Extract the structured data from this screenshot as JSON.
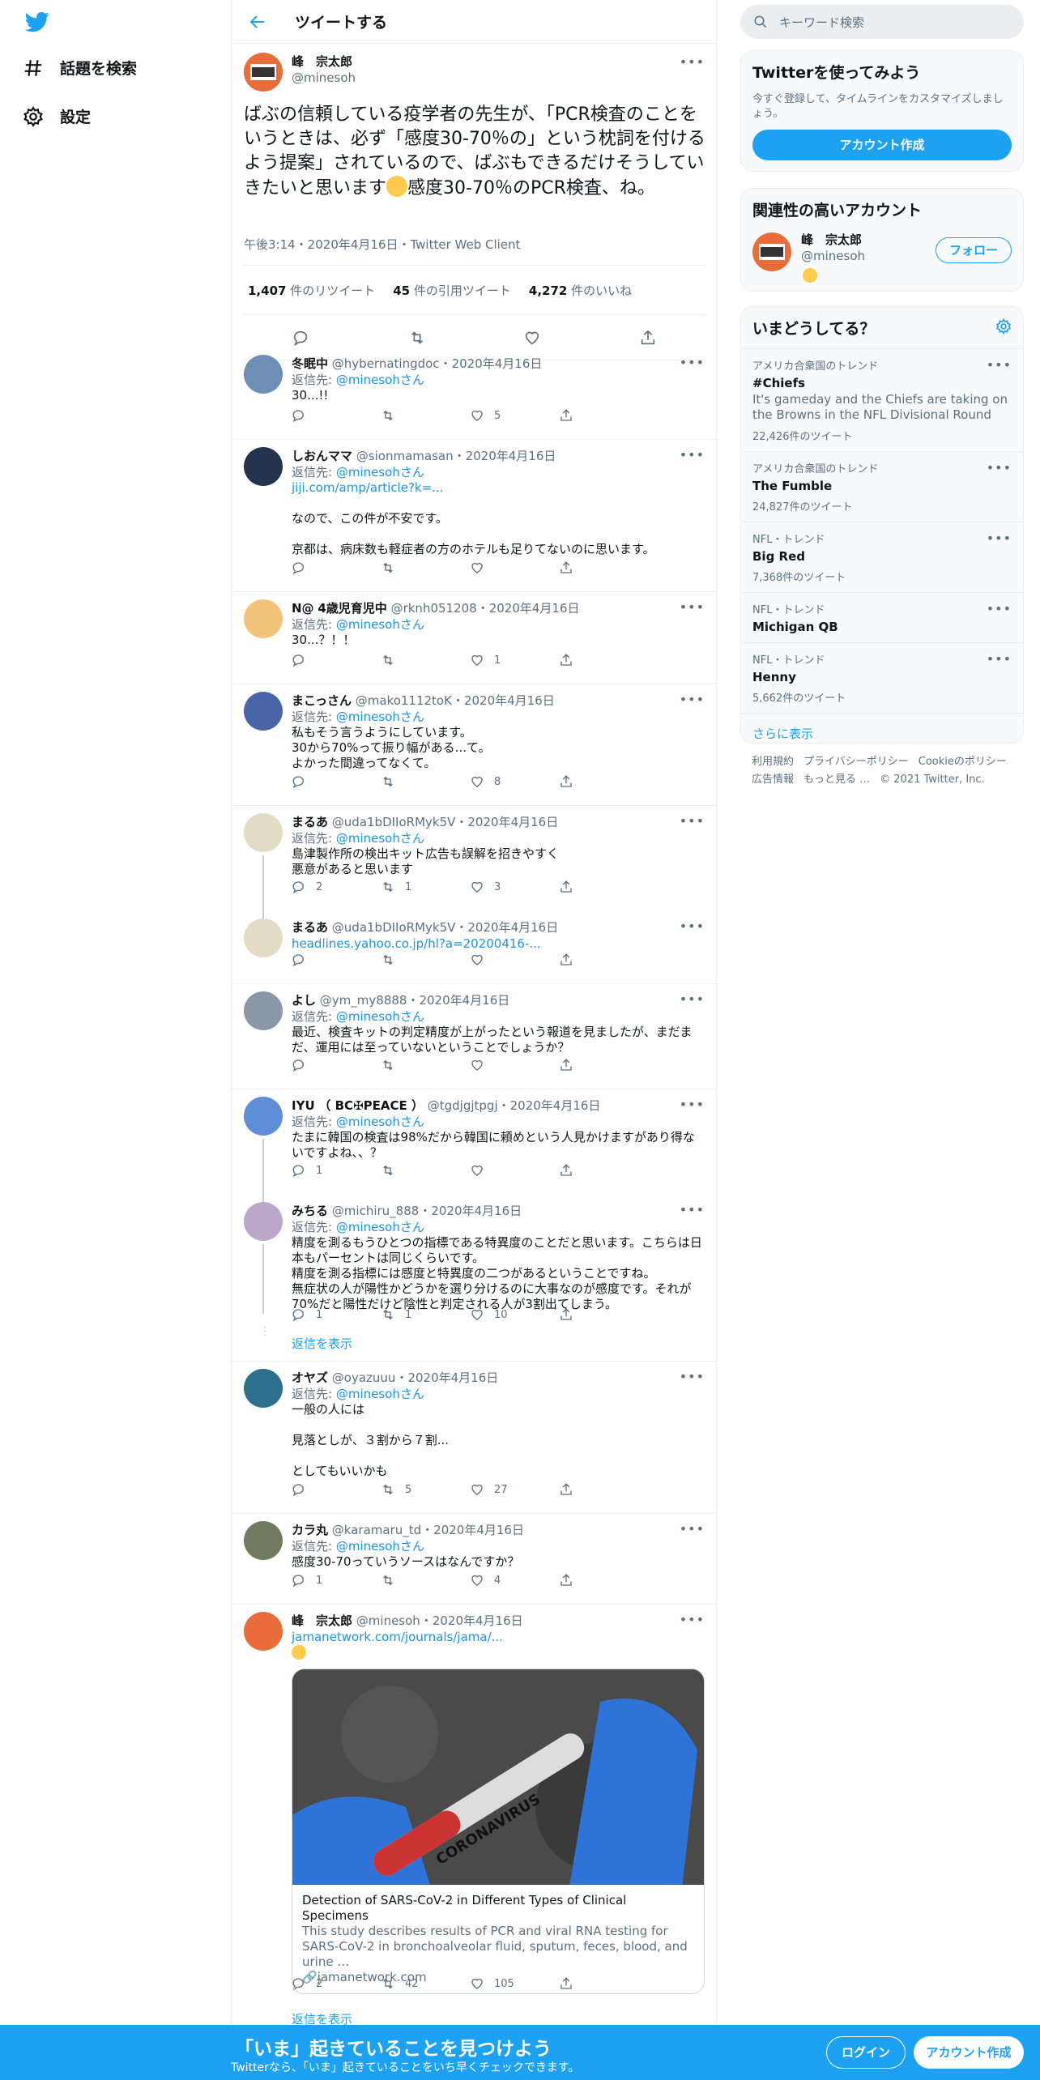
{
  "nav": {
    "explore": "話題を検索",
    "settings": "設定"
  },
  "header": {
    "title": "ツイートする"
  },
  "main_tweet": {
    "name": "峰　宗太郎",
    "handle": "@minesoh",
    "text_part1": "ばぶの信頼している疫学者の先生が、「PCR検査のことをいうときは、必ず「感度30-70％の」という枕詞を付けるよう提案」されているので、ばぶもできるだけそうしていきたいと思います",
    "text_part2": "感度30-70％のPCR検査、ね。",
    "time": "午後3:14・2020年4月16日・Twitter Web Client",
    "retweets": "1,407",
    "retweets_label": "件のリツイート",
    "quotes": "45",
    "quotes_label": "件の引用ツイート",
    "likes": "4,272",
    "likes_label": "件のいいね"
  },
  "reply_to_label": "返信先:",
  "reply_to_handle": "@minesohさん",
  "replies": [
    {
      "name": "冬眠中",
      "handle": "@hybernatingdoc",
      "date": "・2020年4月16日",
      "line1": "30...!!",
      "replies": "",
      "retweets": "",
      "likes": "5"
    },
    {
      "name": "しおんママ",
      "handle": "@sionmamasan",
      "date": "・2020年4月16日",
      "link": "jiji.com/amp/article?k=...",
      "line1": "なので、この件が不安です。",
      "line2": "京都は、病床数も軽症者の方のホテルも足りてないのに思います。",
      "replies": "",
      "retweets": "",
      "likes": ""
    },
    {
      "name": "N@",
      "name2": "4歳児育児中",
      "handle": "@rknh051208",
      "date": "・2020年4月16日",
      "line1": "30...？！！",
      "replies": "",
      "retweets": "",
      "likes": "1"
    },
    {
      "name": "まこっさん",
      "handle": "@mako1112toK",
      "date": "・2020年4月16日",
      "line1": "私もそう言うようにしています。",
      "line2": "30から70%って振り幅がある...て。",
      "line3": "よかった間違ってなくて。",
      "replies": "",
      "retweets": "",
      "likes": "8"
    },
    {
      "name": "まるあ",
      "handle": "@uda1bDIIoRMyk5V",
      "date": "・2020年4月16日",
      "line1": "島津製作所の検出キット広告も誤解を招きやすく",
      "line2": "悪意があると思います",
      "replies": "2",
      "retweets": "1",
      "likes": "3"
    },
    {
      "name": "まるあ",
      "handle": "@uda1bDIIoRMyk5V",
      "date": "・2020年4月16日",
      "link": "headlines.yahoo.co.jp/hl?a=20200416-...",
      "replies": "",
      "retweets": "",
      "likes": ""
    },
    {
      "name": "よし",
      "handle": "@ym_my8888",
      "date": "・2020年4月16日",
      "line1": "最近、検査キットの判定精度が上がったという報道を見ましたが、まだまだ、運用には至っていないということでしょうか？",
      "replies": "",
      "retweets": "",
      "likes": ""
    },
    {
      "name": "IYU",
      "name2": "（ BC✠PEACE ）",
      "handle": "@tgdjgjtpgj",
      "date": "・2020年4月16日",
      "line1": "たまに韓国の検査は98%だから韓国に頼めという人見かけますがあり得ないですよね、、？",
      "replies": "1",
      "retweets": "",
      "likes": ""
    },
    {
      "name": "みちる",
      "handle": "@michiru_888",
      "date": "・2020年4月16日",
      "line1": "精度を測るもうひとつの指標である特異度のことだと思います。こちらは日本もパーセントは同じくらいです。",
      "line2": "精度を測る指標には感度と特異度の二つがあるということですね。",
      "line3": "無症状の人が陽性かどうかを選り分けるのに大事なのが感度です。それが70%だと陽性だけど陰性と判定される人が3割出てしまう。",
      "replies": "1",
      "retweets": "1",
      "likes": "10"
    },
    {
      "name": "オヤズ",
      "handle": "@oyazuuu",
      "date": "・2020年4月16日",
      "line1": "一般の人には",
      "line2": "見落としが、３割から７割...",
      "line3": "としてもいいかも",
      "replies": "",
      "retweets": "5",
      "likes": "27"
    },
    {
      "name": "カラ丸",
      "handle": "@karamaru_td",
      "date": "・2020年4月16日",
      "line1": "感度30-70っていうソースはなんですか？",
      "replies": "1",
      "retweets": "",
      "likes": "4"
    },
    {
      "name": "峰　宗太郎",
      "handle": "@minesoh",
      "date": "・2020年4月16日",
      "link": "jamanetwork.com/journals/jama/...",
      "replies": "2",
      "retweets": "42",
      "likes": "105"
    }
  ],
  "show_replies": "返信を表示",
  "link_card": {
    "image_text": "CORONAVIRUS",
    "title": "Detection of SARS-CoV-2 in Different Types of Clinical Specimens",
    "desc": "This study describes results of PCR and viral RNA testing for SARS-CoV-2 in bronchoalveolar fluid, sputum, feces, blood, and urine …",
    "domain": "jamanetwork.com"
  },
  "sidebar": {
    "search_placeholder": "キーワード検索",
    "signup_title": "Twitterを使ってみよう",
    "signup_sub": "今すぐ登録して、タイムラインをカスタマイズしましょう。",
    "signup_button": "アカウント作成",
    "related_title": "関連性の高いアカウント",
    "related_name": "峰　宗太郎",
    "related_handle": "@minesoh",
    "follow_button": "フォロー",
    "trends_title": "いまどうしてる？",
    "trends": [
      {
        "category": "アメリカ合衆国のトレンド",
        "name": "#Chiefs",
        "desc": "It's gameday and the Chiefs are taking on the Browns in the NFL Divisional Round",
        "count": "22,426件のツイート"
      },
      {
        "category": "アメリカ合衆国のトレンド",
        "name": "The Fumble",
        "desc": "",
        "count": "24,827件のツイート"
      },
      {
        "category": "NFL・トレンド",
        "name": "Big Red",
        "desc": "",
        "count": "7,368件のツイート"
      },
      {
        "category": "NFL・トレンド",
        "name": "Michigan QB",
        "desc": "",
        "count": ""
      },
      {
        "category": "NFL・トレンド",
        "name": "Henny",
        "desc": "",
        "count": "5,662件のツイート"
      }
    ],
    "show_more": "さらに表示",
    "footer": {
      "terms": "利用規約",
      "privacy": "プライバシーポリシー",
      "cookie": "Cookieのポリシー",
      "ads": "広告情報",
      "more": "もっと見る …",
      "copyright": "© 2021 Twitter, Inc."
    }
  },
  "bottom_bar": {
    "title": "「いま」起きていることを見つけよう",
    "sub": "Twitterなら、「いま」起きていることをいち早くチェックできます。",
    "login": "ログイン",
    "signup": "アカウント作成"
  },
  "colors": {
    "accent": "#1da1f2",
    "muted": "#5b7083",
    "border": "#ebeef0"
  }
}
